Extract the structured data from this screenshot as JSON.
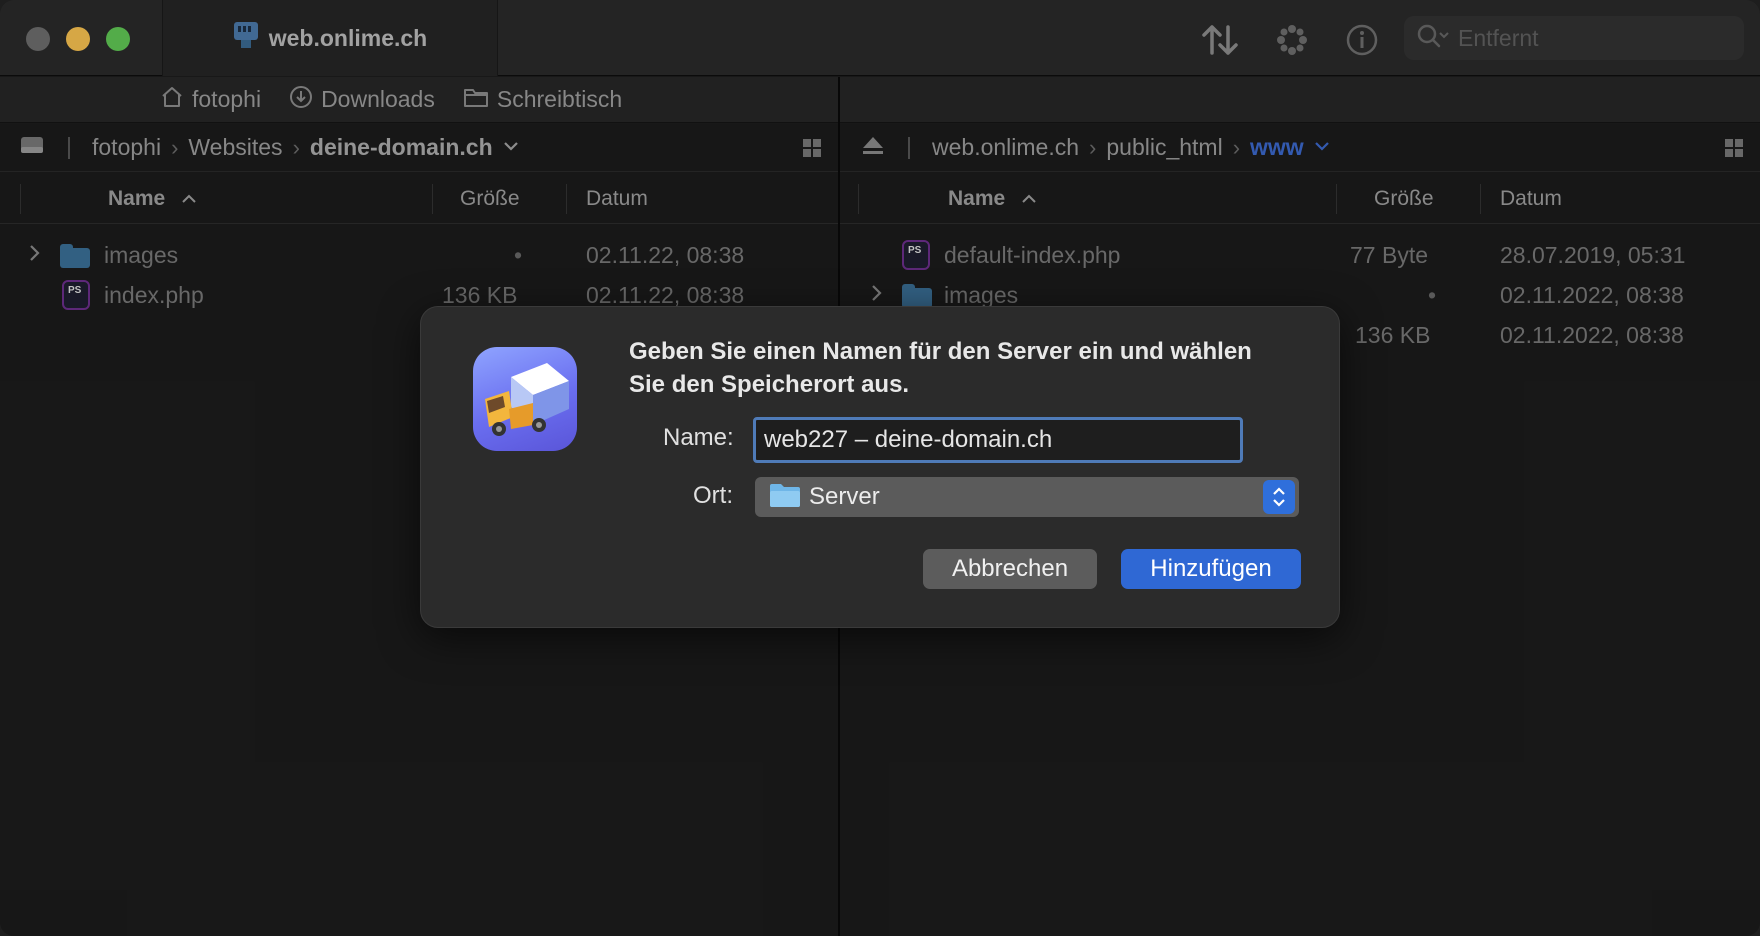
{
  "window": {
    "tab_title": "web.onlime.ch",
    "search_placeholder": "Entfernt"
  },
  "favorites": [
    {
      "label": "fotophi",
      "icon": "home-icon"
    },
    {
      "label": "Downloads",
      "icon": "download-icon"
    },
    {
      "label": "Schreibtisch",
      "icon": "folder-icon"
    }
  ],
  "left_pane": {
    "path": [
      "fotophi",
      "Websites",
      "deine-domain.ch"
    ],
    "columns": {
      "name": "Name",
      "size": "Größe",
      "date": "Datum"
    },
    "rows": [
      {
        "name": "images",
        "size": "•",
        "date": "02.11.22, 08:38",
        "type": "folder"
      },
      {
        "name": "index.php",
        "size": "136 KB",
        "date": "02.11.22, 08:38",
        "type": "php"
      }
    ]
  },
  "right_pane": {
    "path": [
      "web.onlime.ch",
      "public_html",
      "www"
    ],
    "columns": {
      "name": "Name",
      "size": "Größe",
      "date": "Datum"
    },
    "rows": [
      {
        "name": "default-index.php",
        "size": "77 Byte",
        "date": "28.07.2019, 05:31",
        "type": "php"
      },
      {
        "name": "images",
        "size": "•",
        "date": "02.11.2022, 08:38",
        "type": "folder"
      },
      {
        "name": "",
        "size": "136 KB",
        "date": "02.11.2022, 08:38",
        "type": "php"
      }
    ]
  },
  "dialog": {
    "title": "Geben Sie einen Namen für den Server ein und wählen Sie den Speicherort aus.",
    "name_label": "Name:",
    "name_value": "web227 – deine-domain.ch",
    "location_label": "Ort:",
    "location_value": "Server",
    "cancel_label": "Abbrechen",
    "add_label": "Hinzufügen"
  },
  "colors": {
    "accent": "#2f68d4",
    "folder": "#3a6e95",
    "path_active": "#3b67c9"
  }
}
